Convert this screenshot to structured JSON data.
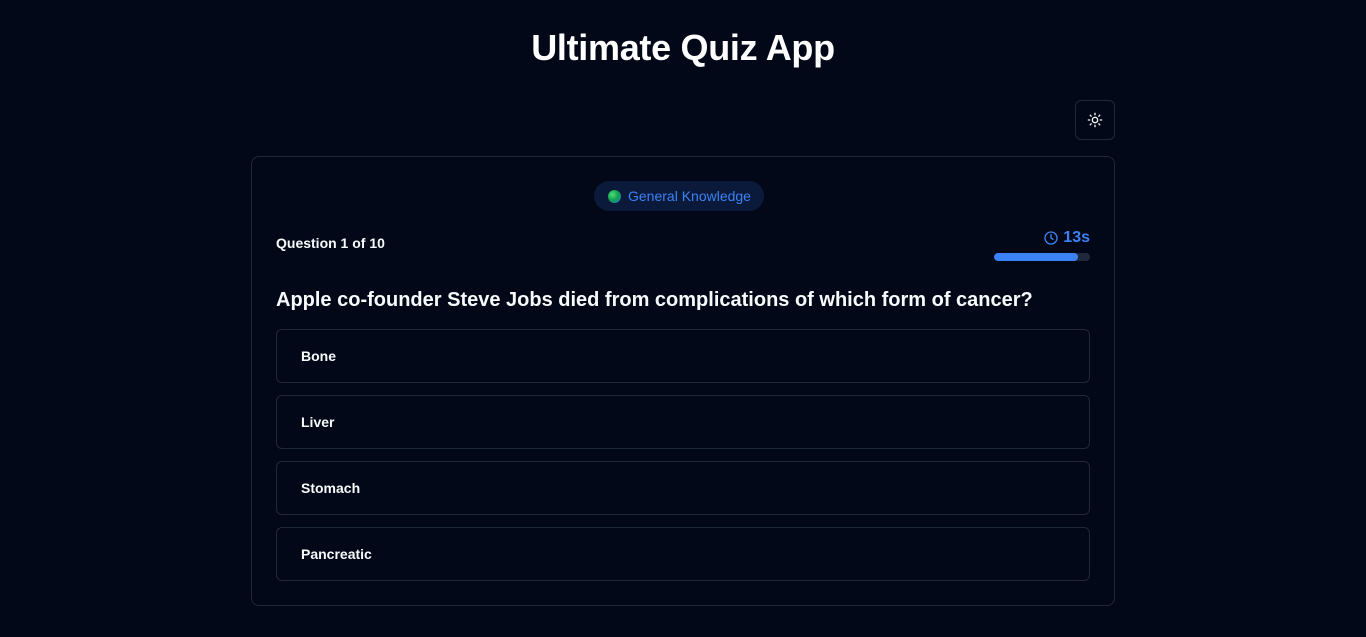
{
  "app": {
    "title": "Ultimate Quiz App"
  },
  "theme_toggle": {
    "icon": "sun-icon"
  },
  "quiz": {
    "category": {
      "label": "General Knowledge",
      "icon": "globe-icon"
    },
    "counter": "Question 1 of 10",
    "timer": {
      "icon": "clock-icon",
      "readout": "13s",
      "remaining_fraction": 0.87
    },
    "question": "Apple co-founder Steve Jobs died from complications of which form of cancer?",
    "options": [
      "Bone",
      "Liver",
      "Stomach",
      "Pancreatic"
    ]
  },
  "colors": {
    "background": "#020817",
    "accent": "#3b82f6",
    "border": "#1e293b",
    "text": "#f8fafc"
  }
}
